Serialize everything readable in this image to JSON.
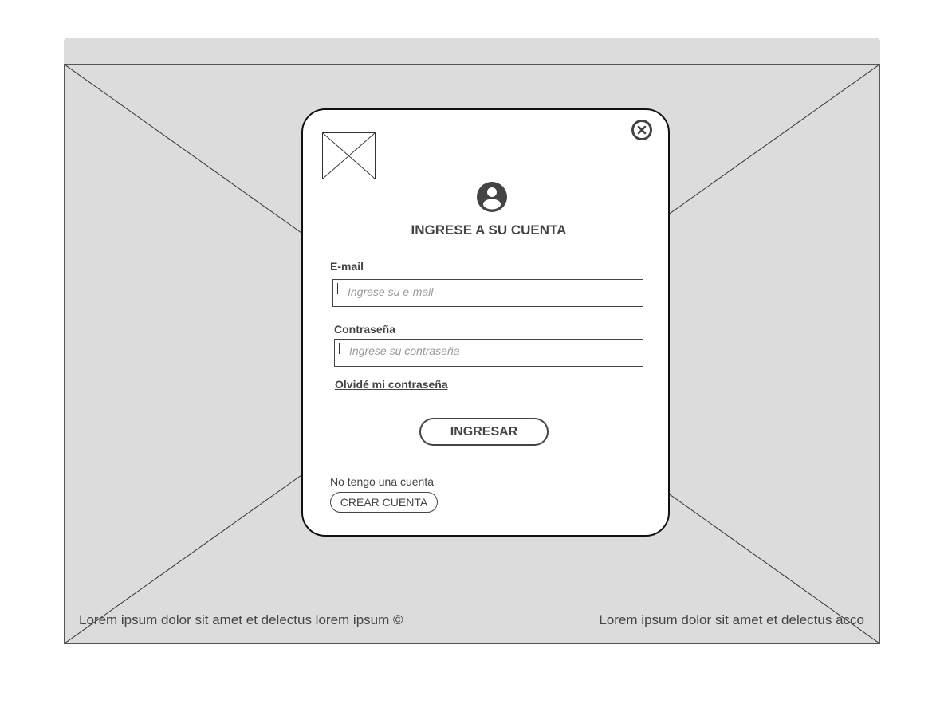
{
  "background": {
    "footer_left": "Lorem ipsum dolor sit amet et delectus lorem ipsum ©",
    "footer_right": "Lorem ipsum dolor sit amet et delectus acco"
  },
  "modal": {
    "close_icon": "close-circle-icon",
    "logo_icon": "image-placeholder-icon",
    "user_icon": "user-circle-icon",
    "title": "INGRESE A SU CUENTA",
    "email": {
      "label": "E-mail",
      "value": "",
      "placeholder": "Ingrese su e-mail"
    },
    "password": {
      "label": "Contraseña",
      "value": "",
      "placeholder": "Ingrese su contraseña"
    },
    "forgot_link": "Olvidé mi contraseña",
    "login_button": "INGRESAR",
    "no_account_text": "No tengo una cuenta",
    "create_account_button": "CREAR CUENTA"
  },
  "colors": {
    "background_gray": "#dcdcdc",
    "text": "#444444",
    "border": "#111111"
  }
}
